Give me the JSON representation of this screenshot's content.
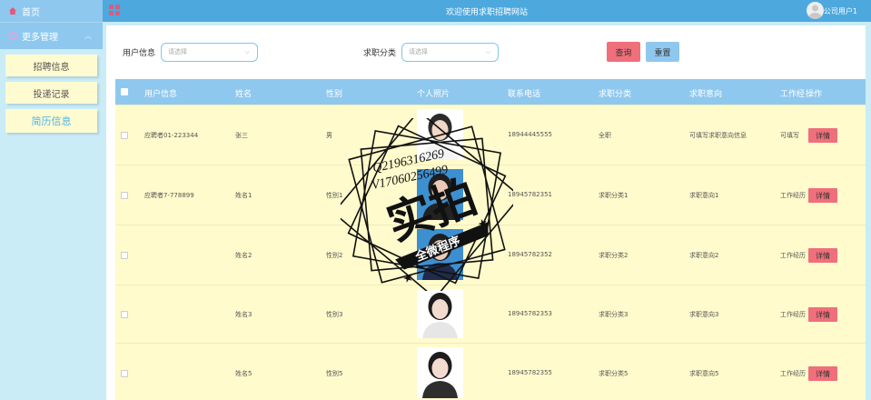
{
  "sidebar": {
    "home_label": "首页",
    "more_label": "更多管理",
    "items": [
      {
        "label": "招聘信息"
      },
      {
        "label": "投递记录"
      },
      {
        "label": "简历信息"
      }
    ]
  },
  "header": {
    "title": "欢迎使用求职招聘网站",
    "username": "公司用户1"
  },
  "filters": {
    "user_info_label": "用户信息",
    "user_info_placeholder": "请选择",
    "category_label": "求职分类",
    "category_placeholder": "请选择",
    "search_button": "查询",
    "reset_button": "重置"
  },
  "table": {
    "columns": [
      "用户信息",
      "姓名",
      "性别",
      "个人照片",
      "联系电话",
      "求职分类",
      "求职意向",
      "工作经",
      "操作"
    ],
    "detail_label": "详情",
    "rows": [
      {
        "user": "应聘者01-223344",
        "name": "张三",
        "gender": "男",
        "phone": "18944445555",
        "category": "全职",
        "intent": "可填写求职意向信息",
        "experience": "可填写"
      },
      {
        "user": "应聘者7-778899",
        "name": "姓名1",
        "gender": "性别1",
        "phone": "18945782351",
        "category": "求职分类1",
        "intent": "求职意向1",
        "experience": "工作经历"
      },
      {
        "user": "",
        "name": "姓名2",
        "gender": "性别2",
        "phone": "18945782352",
        "category": "求职分类2",
        "intent": "求职意向2",
        "experience": "工作经历"
      },
      {
        "user": "",
        "name": "姓名3",
        "gender": "性别3",
        "phone": "18945782353",
        "category": "求职分类3",
        "intent": "求职意向3",
        "experience": "工作经历"
      },
      {
        "user": "",
        "name": "姓名5",
        "gender": "性别5",
        "phone": "18945782355",
        "category": "求职分类5",
        "intent": "求职意向5",
        "experience": "工作经历"
      }
    ]
  },
  "watermark": {
    "line1": "Q2196316269",
    "line2": "V17060256499",
    "big": "实拍",
    "banner": "全微程序"
  },
  "colors": {
    "header": "#4da8de",
    "sidebar": "#8fc8ee",
    "row_bg": "#fffbcc",
    "danger": "#ef6f7b"
  }
}
